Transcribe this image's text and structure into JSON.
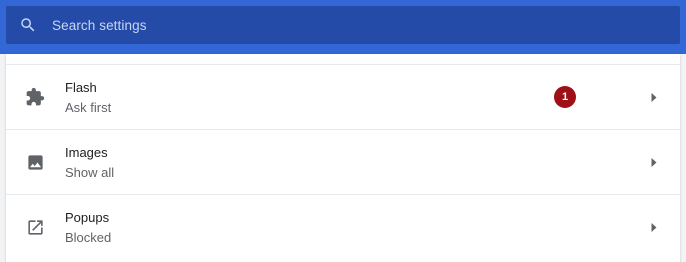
{
  "search": {
    "placeholder": "Search settings",
    "icon": "search-icon"
  },
  "colors": {
    "header": "#3367d6",
    "search_bar": "#234ba7",
    "badge": "#9e0f16"
  },
  "settings": [
    {
      "title": "Flash",
      "subtitle": "Ask first",
      "icon": "puzzle-icon",
      "badge": "1"
    },
    {
      "title": "Images",
      "subtitle": "Show all",
      "icon": "image-icon"
    },
    {
      "title": "Popups",
      "subtitle": "Blocked",
      "icon": "open-in-new-icon"
    }
  ]
}
